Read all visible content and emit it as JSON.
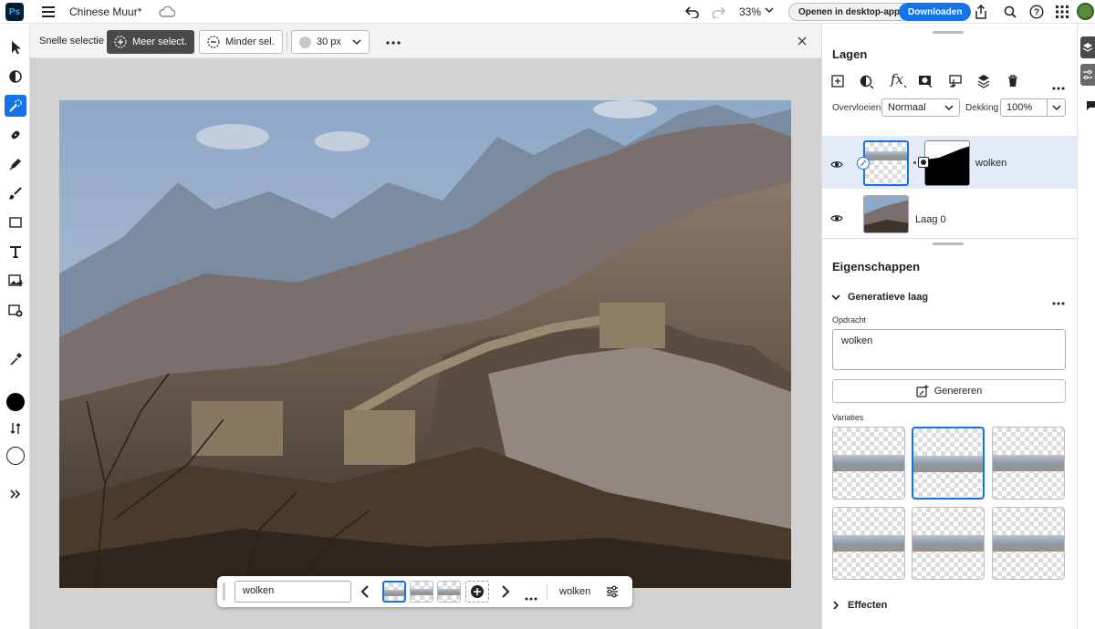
{
  "app": {
    "logo": "Ps",
    "doc_title": "Chinese Muur*",
    "zoom": "33%",
    "open_desktop_label": "Openen in desktop-app",
    "download_label": "Downloaden"
  },
  "options_bar": {
    "tool_name": "Snelle selectie",
    "add_label": "Meer select.",
    "subtract_label": "Minder sel.",
    "brush_size": "30 px"
  },
  "layers_panel": {
    "title": "Lagen",
    "blend_label": "Overvloeien",
    "blend_value": "Normaal",
    "opacity_label": "Dekking",
    "opacity_value": "100%",
    "layers": [
      {
        "name": "wolken",
        "selected": true
      },
      {
        "name": "Laag 0",
        "selected": false
      }
    ]
  },
  "properties": {
    "title": "Eigenschappen",
    "section_title": "Generatieve laag",
    "prompt_label": "Opdracht",
    "prompt_value": "wolken",
    "generate_label": "Genereren",
    "variations_label": "Variaties",
    "effects_label": "Effecten"
  },
  "taskbar": {
    "prompt_value": "wolken",
    "layer_name": "wolken"
  },
  "colors": {
    "accent": "#1473e6",
    "panel_bg": "#ffffff",
    "canvas_bg": "#d2d2d2",
    "selected_row": "#e3ebf9"
  }
}
